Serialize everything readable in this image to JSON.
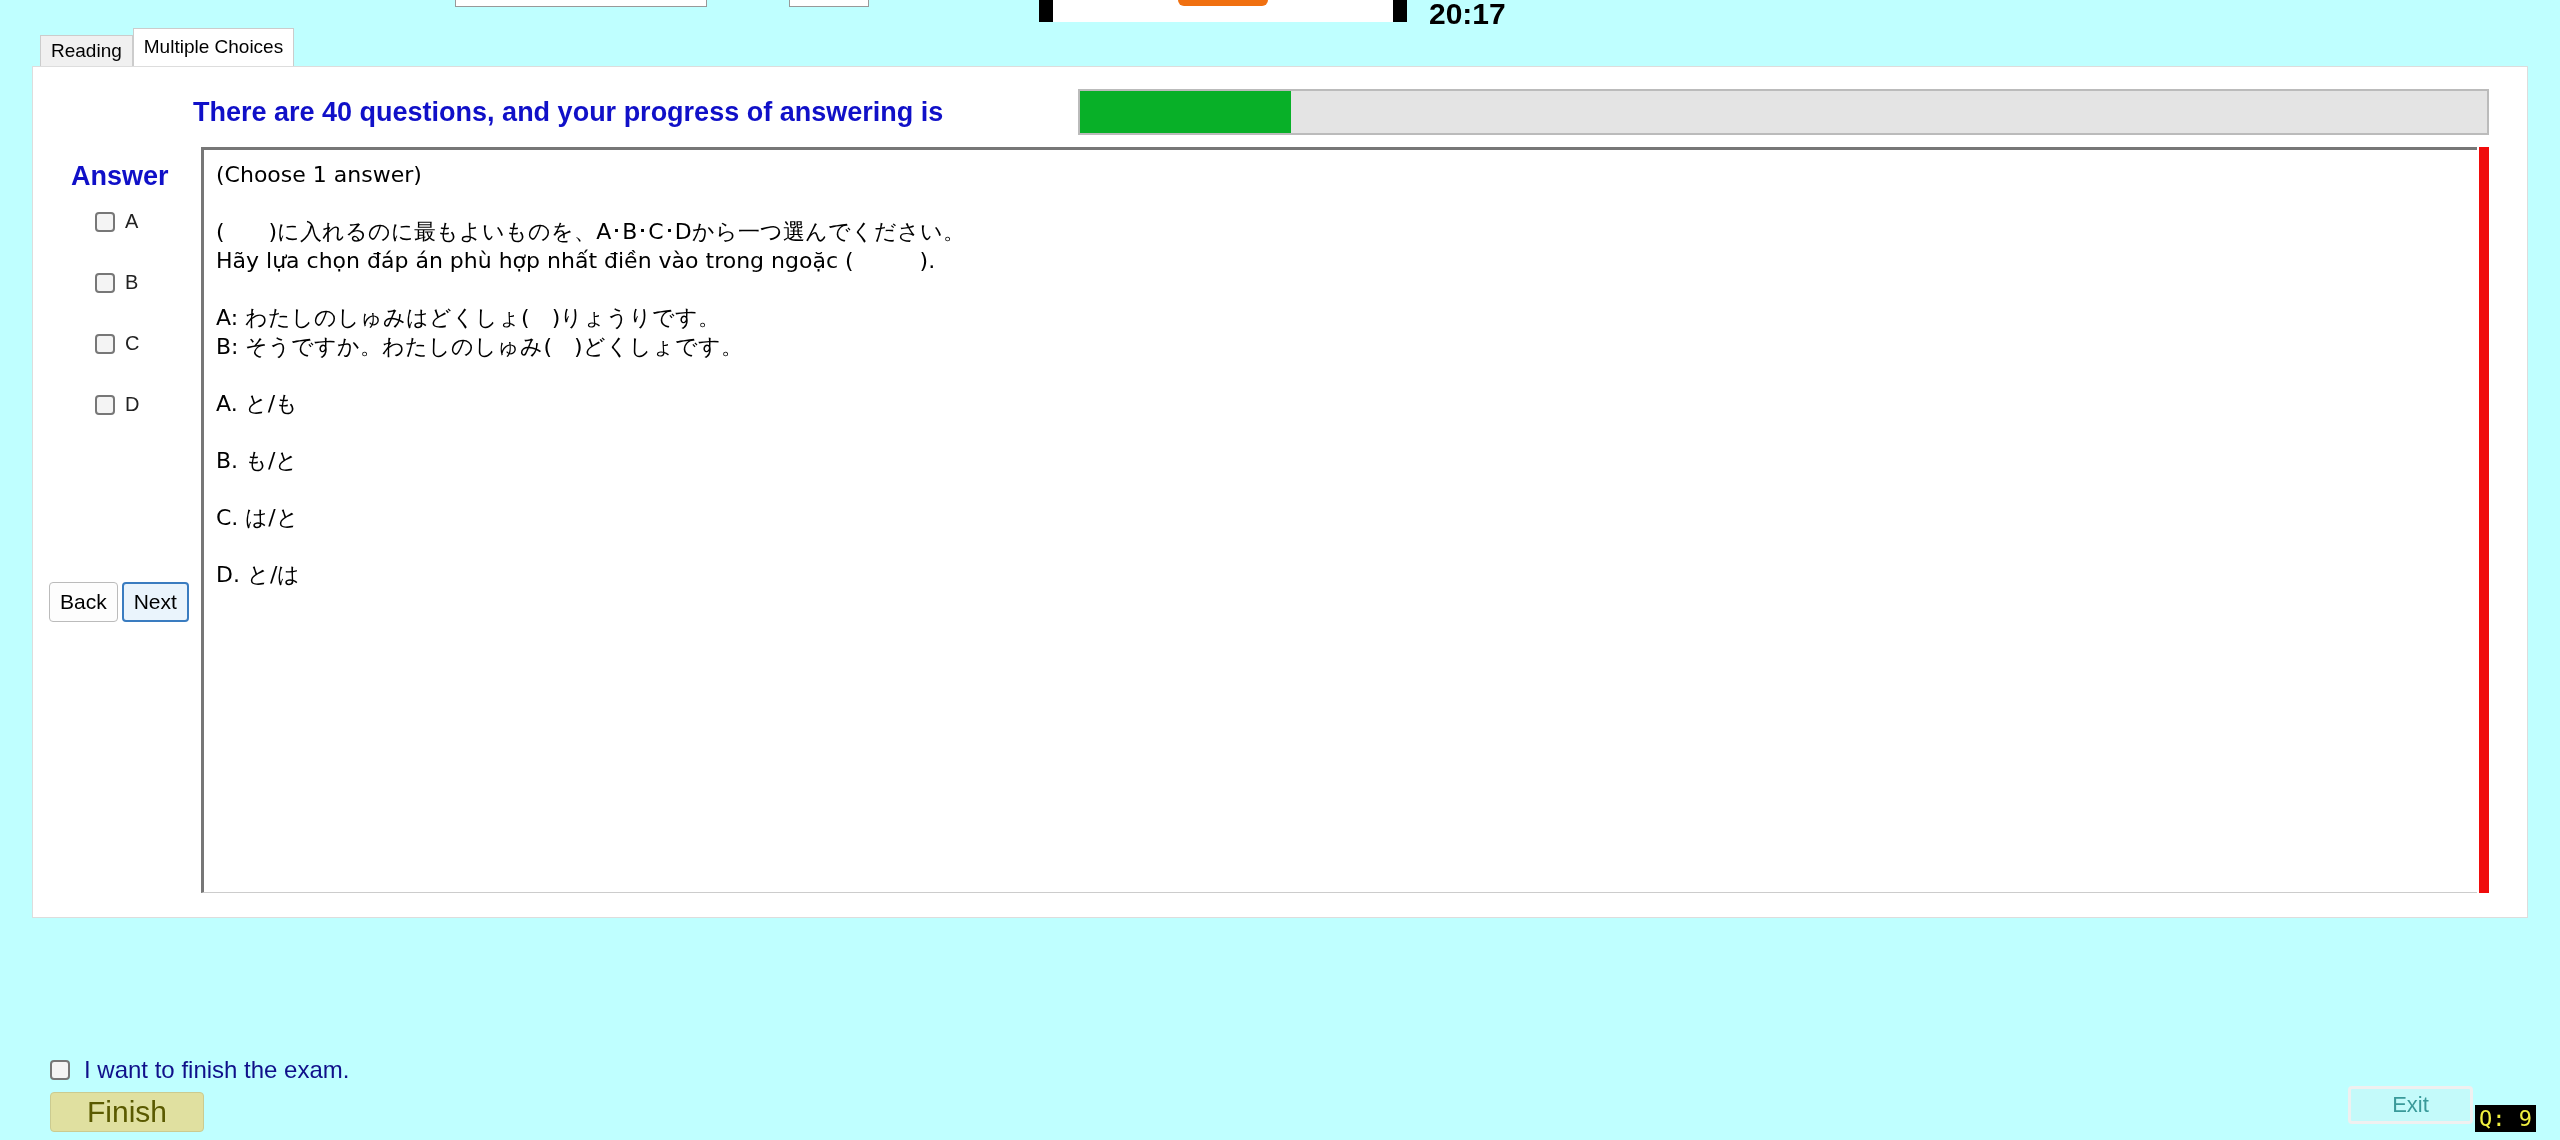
{
  "timer": "20:17",
  "tabs": [
    {
      "label": "Reading",
      "selected": false
    },
    {
      "label": "Multiple Choices",
      "selected": true
    }
  ],
  "progress": {
    "label": "There are 40 questions, and your progress of answering is",
    "level": 0.15
  },
  "answer": {
    "title": "Answer",
    "options": [
      {
        "label": "A",
        "checked": false
      },
      {
        "label": "B",
        "checked": false
      },
      {
        "label": "C",
        "checked": false
      },
      {
        "label": "D",
        "checked": false
      }
    ]
  },
  "nav_buttons": [
    {
      "label": "Back",
      "focused": false
    },
    {
      "label": "Next",
      "focused": true
    }
  ],
  "question": {
    "paragraphs": [
      [
        "(Choose 1 answer)"
      ],
      [
        "(　　)に入れるのに最もよいものを、A･B･C･Dから一つ選んでください。",
        "Hãy lựa chọn đáp án phù hợp nhất điền vào trong ngoặc (　　　)."
      ],
      [
        "A:  わたしのしゅみはどくしょ(　)りょうりです。",
        "B:  そうですか。わたしのしゅみ(　)どくしょです。"
      ],
      [
        "A. と/も"
      ],
      [
        "B. も/と"
      ],
      [
        "C.  は/と"
      ],
      [
        "D. と/は"
      ]
    ]
  },
  "finish": {
    "confirm": {
      "label": "I want to finish the exam.",
      "checked": false
    },
    "button": "Finish"
  },
  "exit_button": "Exit",
  "question_counter": "Q: 9"
}
